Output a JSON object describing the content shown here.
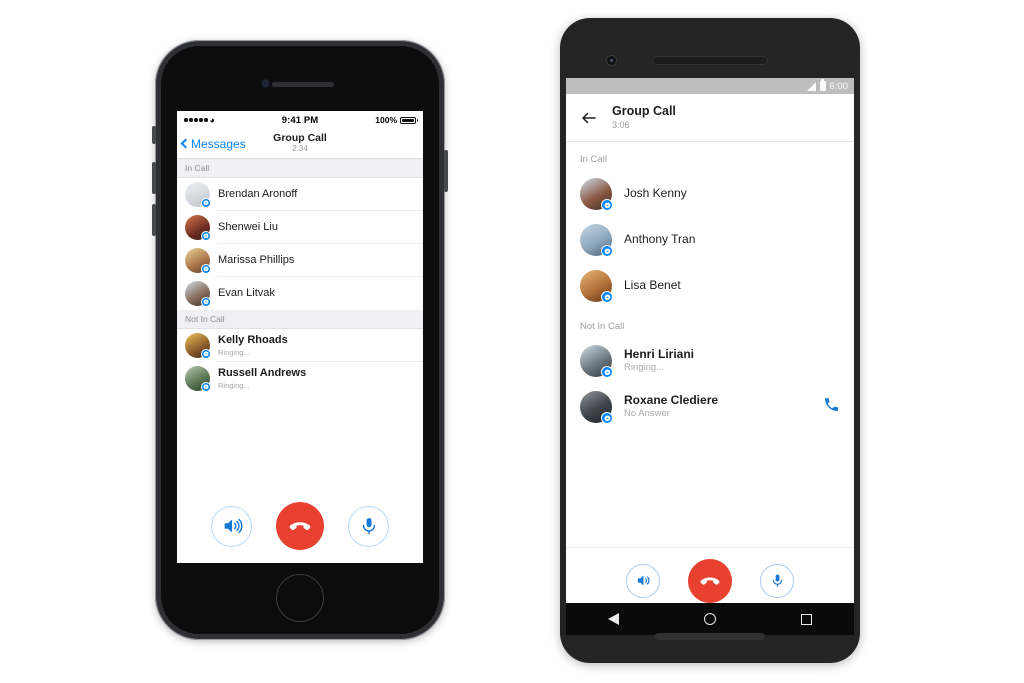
{
  "iphone": {
    "status_bar": {
      "carrier_dots": 5,
      "wifi_icon": "wifi-icon",
      "time": "9:41 PM",
      "battery_percent": "100%"
    },
    "nav": {
      "back_label": "Messages",
      "title": "Group Call",
      "timer": "2:34"
    },
    "sections": [
      {
        "header": "In Call",
        "rows": [
          {
            "name": "Brendan Aronoff",
            "status": "",
            "avatar_color": "#c9cdd4",
            "badge": "messenger-icon"
          },
          {
            "name": "Shenwei Liu",
            "status": "",
            "avatar_color": "#a4543c",
            "badge": "messenger-icon"
          },
          {
            "name": "Marissa Phillips",
            "status": "",
            "avatar_color": "#c7a86a",
            "badge": "messenger-icon"
          },
          {
            "name": "Evan Litvak",
            "status": "",
            "avatar_color": "#9fb3c4",
            "badge": "messenger-icon"
          }
        ]
      },
      {
        "header": "Not In Call",
        "rows": [
          {
            "name": "Kelly Rhoads",
            "status": "Ringing...",
            "avatar_color": "#e0a83c",
            "badge": "messenger-icon"
          },
          {
            "name": "Russell Andrews",
            "status": "Ringing...",
            "avatar_color": "#7e9a78",
            "badge": "messenger-icon"
          }
        ]
      }
    ],
    "actions": [
      {
        "name": "speaker-button",
        "icon": "speaker-icon"
      },
      {
        "name": "end-call-button",
        "icon": "end-call-icon"
      },
      {
        "name": "microphone-button",
        "icon": "microphone-icon"
      }
    ]
  },
  "android": {
    "status_bar": {
      "signal_icon": "signal-icon",
      "battery_icon": "battery-icon",
      "time": "6:00"
    },
    "appbar": {
      "back_icon": "arrow-back-icon",
      "title": "Group Call",
      "timer": "3:06"
    },
    "sections": [
      {
        "header": "In Call",
        "rows": [
          {
            "name": "Josh Kenny",
            "status": "",
            "avatar_color": "#8d5a46",
            "badge": "messenger-icon",
            "action": ""
          },
          {
            "name": "Anthony Tran",
            "status": "",
            "avatar_color": "#a8bdd0",
            "badge": "messenger-icon",
            "action": ""
          },
          {
            "name": "Lisa Benet",
            "status": "",
            "avatar_color": "#c98a4b",
            "badge": "messenger-icon",
            "action": ""
          }
        ]
      },
      {
        "header": "Not In Call",
        "rows": [
          {
            "name": "Henri Liriani",
            "status": "Ringing...",
            "avatar_color": "#7f8a93",
            "badge": "messenger-icon",
            "action": ""
          },
          {
            "name": "Roxane Clediere",
            "status": "No Answer",
            "avatar_color": "#4b4f57",
            "badge": "messenger-icon",
            "action": "call-back-icon"
          }
        ]
      }
    ],
    "actions": [
      {
        "name": "speaker-button",
        "icon": "speaker-icon"
      },
      {
        "name": "end-call-button",
        "icon": "end-call-icon"
      },
      {
        "name": "microphone-button",
        "icon": "microphone-icon"
      }
    ],
    "navbar": [
      {
        "name": "nav-back-button",
        "icon": "triangle-icon"
      },
      {
        "name": "nav-home-button",
        "icon": "circle-icon"
      },
      {
        "name": "nav-recents-button",
        "icon": "square-icon"
      }
    ]
  },
  "colors": {
    "accent_blue": "#0084ff",
    "end_call_red": "#e8412f",
    "ios_link": "#0a84ff",
    "muted_text": "#a9a9ae"
  }
}
